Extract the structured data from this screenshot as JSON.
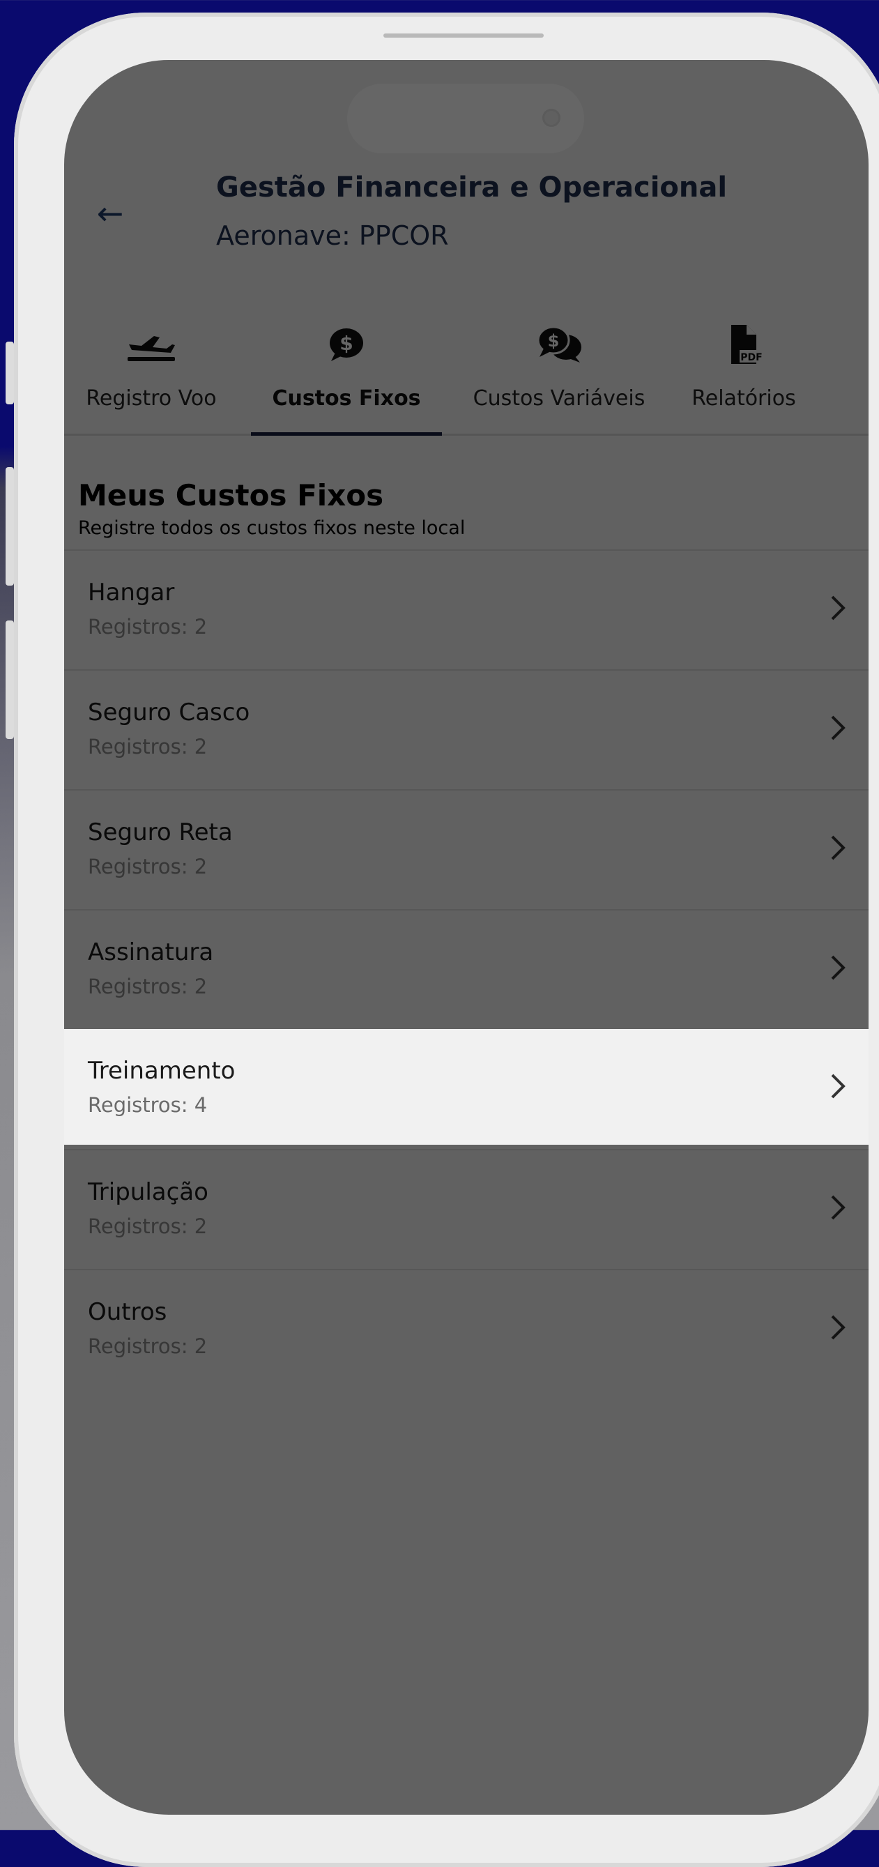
{
  "header": {
    "title": "Gestão Financeira e Operacional",
    "subtitle": "Aeronave: PPCOR"
  },
  "tabs": [
    {
      "label": "Registro Voo",
      "icon": "plane-departure-icon"
    },
    {
      "label": "Custos Fixos",
      "icon": "dollar-chat-icon",
      "active": true
    },
    {
      "label": "Custos Variáveis",
      "icon": "dollar-chats-icon"
    },
    {
      "label": "Relatórios",
      "icon": "pdf-file-icon"
    }
  ],
  "section": {
    "title": "Meus Custos Fixos",
    "subtitle": "Registre todos os custos fixos neste local"
  },
  "items": [
    {
      "name": "Hangar",
      "count": "Registros: 2"
    },
    {
      "name": "Seguro Casco",
      "count": "Registros: 2"
    },
    {
      "name": "Seguro Reta",
      "count": "Registros: 2"
    },
    {
      "name": "Assinatura",
      "count": "Registros: 2"
    },
    {
      "name": "Treinamento",
      "count": "Registros: 4"
    },
    {
      "name": "Tripulação",
      "count": "Registros: 2"
    },
    {
      "name": "Outros",
      "count": "Registros: 2"
    }
  ],
  "colors": {
    "primary": "#1f2f4f",
    "background_top": "#0a0a6e"
  }
}
